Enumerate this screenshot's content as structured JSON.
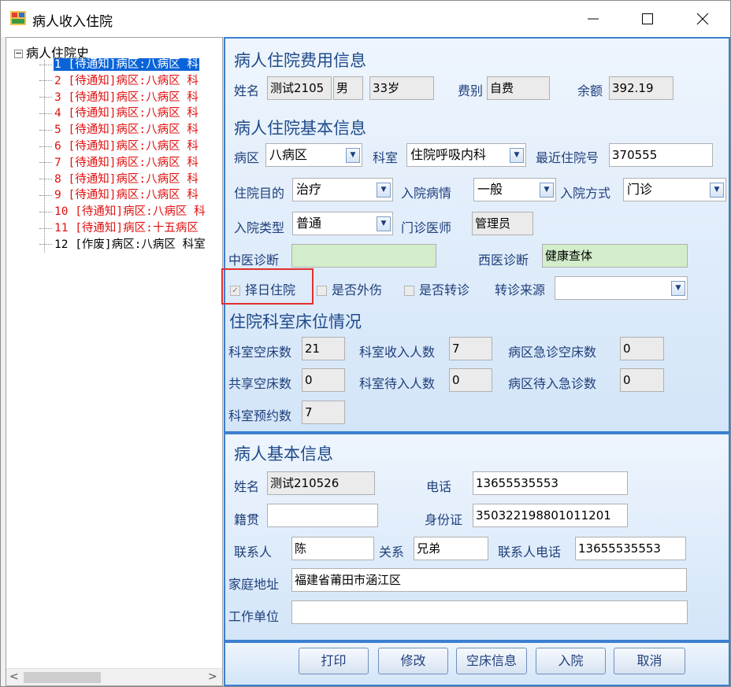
{
  "window": {
    "title": "病人收入住院",
    "minimize": "—",
    "maximize": "☐",
    "close": "✕"
  },
  "tree": {
    "root": "病人住院史",
    "items": [
      {
        "text": "1 [待通知]病区:八病区 科",
        "style": "sel"
      },
      {
        "text": "2 [待通知]病区:八病区 科",
        "style": "red"
      },
      {
        "text": "3 [待通知]病区:八病区 科",
        "style": "red"
      },
      {
        "text": "4 [待通知]病区:八病区 科",
        "style": "red"
      },
      {
        "text": "5 [待通知]病区:八病区 科",
        "style": "red"
      },
      {
        "text": "6 [待通知]病区:八病区 科",
        "style": "red"
      },
      {
        "text": "7 [待通知]病区:八病区 科",
        "style": "red"
      },
      {
        "text": "8 [待通知]病区:八病区 科",
        "style": "red"
      },
      {
        "text": "9 [待通知]病区:八病区 科",
        "style": "red"
      },
      {
        "text": "10 [待通知]病区:八病区 科",
        "style": "red"
      },
      {
        "text": "11 [待通知]病区:十五病区",
        "style": "red"
      },
      {
        "text": "12 [作废]病区:八病区 科室",
        "style": "blk"
      }
    ]
  },
  "fee": {
    "section": "病人住院费用信息",
    "name_label": "姓名",
    "name": "测试2105",
    "sex": "男",
    "age": "33岁",
    "type_label": "费别",
    "type": "自费",
    "balance_label": "余额",
    "balance": "392.19"
  },
  "basic": {
    "section": "病人住院基本信息",
    "ward_label": "病区",
    "ward": "八病区",
    "dept_label": "科室",
    "dept": "住院呼吸内科",
    "recent_label": "最近住院号",
    "recent": "370555",
    "purpose_label": "住院目的",
    "purpose": "治疗",
    "condition_label": "入院病情",
    "condition": "一般",
    "mode_label": "入院方式",
    "mode": "门诊",
    "adm_type_label": "入院类型",
    "adm_type": "普通",
    "doctor_label": "门诊医师",
    "doctor": "管理员",
    "tcm_label": "中医诊断",
    "tcm": "",
    "wm_label": "西医诊断",
    "wm": "健康查体",
    "select_day": "择日住院",
    "external": "是否外伤",
    "transfer": "是否转诊",
    "transfer_src_label": "转诊来源",
    "transfer_src": ""
  },
  "beds": {
    "section": "住院科室床位情况",
    "empty_label": "科室空床数",
    "empty": "21",
    "admitted_label": "科室收入人数",
    "admitted": "7",
    "er_empty_label": "病区急诊空床数",
    "er_empty": "0",
    "shared_label": "共享空床数",
    "shared": "0",
    "waiting_label": "科室待入人数",
    "waiting": "0",
    "er_wait_label": "病区待入急诊数",
    "er_wait": "0",
    "reserve_label": "科室预约数",
    "reserve": "7"
  },
  "patient": {
    "section": "病人基本信息",
    "name_label": "姓名",
    "name": "测试210526",
    "phone_label": "电话",
    "phone": "13655535553",
    "native_label": "籍贯",
    "native": "",
    "id_label": "身份证",
    "id": "350322198801011201",
    "contact_label": "联系人",
    "contact": "陈",
    "relation_label": "关系",
    "relation": "兄弟",
    "contact_phone_label": "联系人电话",
    "contact_phone": "13655535553",
    "address_label": "家庭地址",
    "address": "福建省莆田市涵江区",
    "work_label": "工作单位",
    "work": ""
  },
  "buttons": {
    "print": "打印",
    "edit": "修改",
    "empty_bed": "空床信息",
    "admit": "入院",
    "cancel": "取消"
  }
}
